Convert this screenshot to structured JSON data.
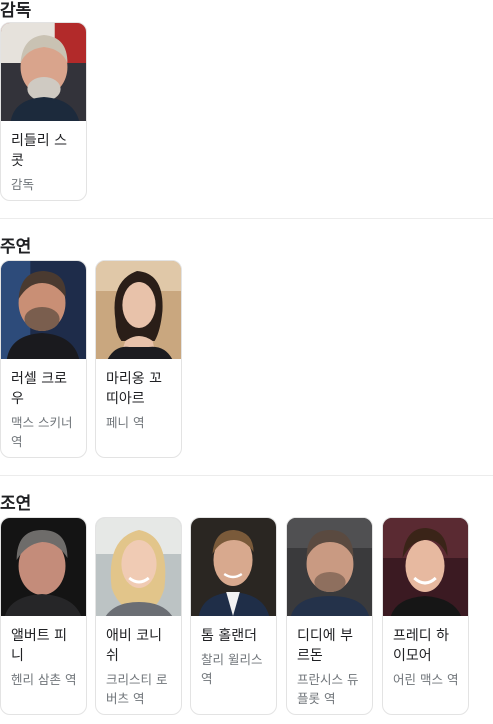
{
  "sections": {
    "director": {
      "title": "감독",
      "cards": [
        {
          "name": "리들리 스콧",
          "role": "감독",
          "photo": "ridley-scott-photo"
        }
      ]
    },
    "lead": {
      "title": "주연",
      "cards": [
        {
          "name": "러셀 크로우",
          "role": "맥스 스키너 역",
          "photo": "russell-crowe-photo"
        },
        {
          "name": "마리옹 꼬띠아르",
          "role": "페니 역",
          "photo": "marion-cotillard-photo"
        }
      ]
    },
    "supporting": {
      "title": "조연",
      "cards": [
        {
          "name": "앨버트 피니",
          "role": "헨리 삼촌 역",
          "photo": "albert-finney-photo"
        },
        {
          "name": "애비 코니쉬",
          "role": "크리스티 로버츠 역",
          "photo": "abbie-cornish-photo"
        },
        {
          "name": "톰 홀랜더",
          "role": "찰리 윌리스 역",
          "photo": "tom-hollander-photo"
        },
        {
          "name": "디디에 부르돈",
          "role": "프란시스 듀플롯 역",
          "photo": "didier-bourdon-photo"
        },
        {
          "name": "프레디 하이모어",
          "role": "어린 맥스 역",
          "photo": "freddie-highmore-photo"
        }
      ]
    }
  },
  "colors": {
    "text": "#202124",
    "secondary_text": "#70757a",
    "card_border": "#e3e3e3",
    "divider": "#ececec"
  }
}
